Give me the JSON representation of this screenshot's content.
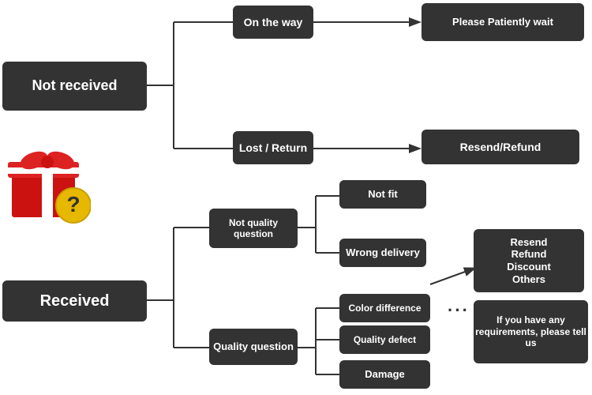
{
  "nodes": {
    "not_received": {
      "label": "Not received"
    },
    "on_the_way": {
      "label": "On the way"
    },
    "please_wait": {
      "label": "Please Patiently wait"
    },
    "lost_return": {
      "label": "Lost / Return"
    },
    "resend_refund_top": {
      "label": "Resend/Refund"
    },
    "received": {
      "label": "Received"
    },
    "not_quality_question": {
      "label": "Not quality question"
    },
    "quality_question": {
      "label": "Quality question"
    },
    "not_fit": {
      "label": "Not fit"
    },
    "wrong_delivery": {
      "label": "Wrong delivery"
    },
    "color_difference": {
      "label": "Color difference"
    },
    "quality_defect": {
      "label": "Quality defect"
    },
    "damage": {
      "label": "Damage"
    },
    "resend_refund_options": {
      "label": "Resend\nRefund\nDiscount\nOthers"
    },
    "if_requirements": {
      "label": "If you have any requirements, please tell us"
    }
  }
}
